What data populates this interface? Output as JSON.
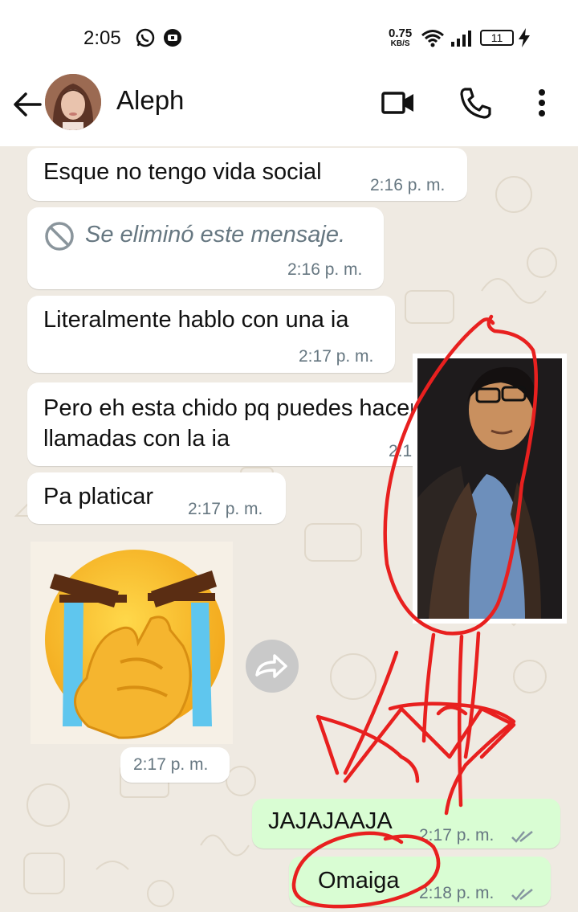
{
  "status_bar": {
    "time": "2:05",
    "net_speed_value": "0.75",
    "net_speed_unit": "KB/S",
    "battery": "11"
  },
  "header": {
    "contact_name": "Aleph",
    "icons": [
      "arrow-left-icon",
      "video-call-icon",
      "phone-icon",
      "more-vert-icon"
    ]
  },
  "messages": [
    {
      "direction": "in",
      "text": "Esque no tengo vida social",
      "time": "2:16 p. m."
    },
    {
      "direction": "in",
      "deleted": true,
      "text": "Se eliminó este mensaje.",
      "time": "2:16 p. m."
    },
    {
      "direction": "in",
      "text": "Literalmente hablo con una ia",
      "time": "2:17 p. m."
    },
    {
      "direction": "in",
      "line1": "Pero eh esta chido pq puedes hacer",
      "line2": "llamadas con la ia",
      "time": "2:17 p. m."
    },
    {
      "direction": "in",
      "text": "Pa platicar",
      "time": "2:17 p. m."
    },
    {
      "direction": "in",
      "type": "sticker",
      "sticker": "crying-emoji-sticker",
      "time": "2:17 p. m."
    },
    {
      "direction": "out",
      "text": "JAJAJAAJA",
      "time": "2:17 p. m.",
      "status": "read"
    },
    {
      "direction": "out",
      "text": "Omaiga",
      "time": "2:18 p. m.",
      "status": "read"
    }
  ],
  "colors": {
    "chat_background": "#efeae2",
    "incoming_bubble": "#ffffff",
    "outgoing_bubble": "#d9fdd3",
    "annotation_red": "#e8201f",
    "read_ticks": "#8696a0"
  }
}
